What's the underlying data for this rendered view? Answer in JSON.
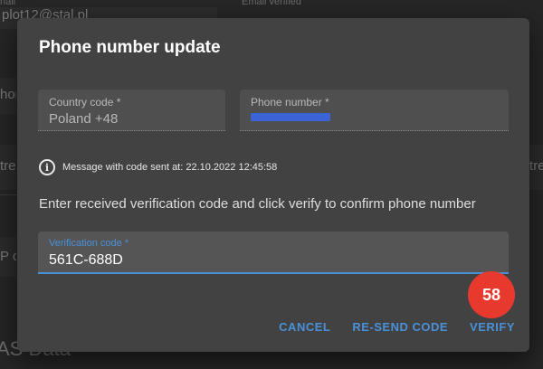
{
  "background": {
    "email_label": "nail",
    "email_value": "plot12@stal.pl",
    "email_verified_label": "Email verified",
    "fragment_left_1": "hor",
    "fragment_left_2": "tre",
    "fragment_left_3": "P c",
    "fragment_right_1": "tre",
    "section_heading": "AS Data"
  },
  "dialog": {
    "title": "Phone number update",
    "country_code": {
      "label": "Country code *",
      "value": "Poland +48"
    },
    "phone_number": {
      "label": "Phone number *",
      "value_redacted": true
    },
    "info_icon": "info-circle-icon",
    "sent_message": "Message with code sent at: 22.10.2022 12:45:58",
    "instruction": "Enter received verification code and click verify to confirm phone number",
    "verification_code": {
      "label": "Verification code *",
      "value": "561C-688D"
    },
    "actions": {
      "cancel": "CANCEL",
      "resend": "RE-SEND CODE",
      "verify": "VERIFY"
    }
  },
  "badge": {
    "count": "58",
    "color": "#e8392f"
  },
  "colors": {
    "accent": "#4a90d9",
    "dialog_bg": "#424242"
  }
}
